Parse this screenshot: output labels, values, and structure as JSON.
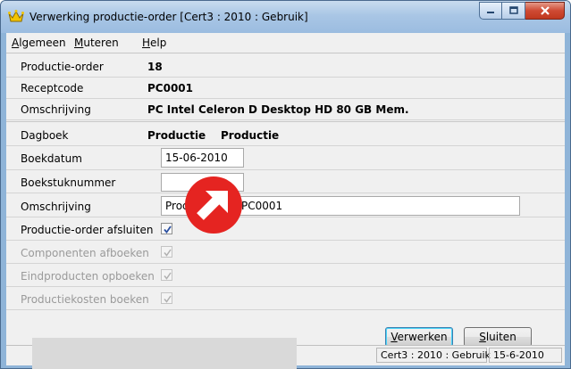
{
  "window": {
    "title": "Verwerking productie-order  [Cert3 : 2010 : Gebruik]"
  },
  "menu": {
    "items": [
      {
        "label": "Algemeen"
      },
      {
        "label": "Muteren"
      },
      {
        "label": "Help"
      }
    ]
  },
  "header_fields": [
    {
      "label": "Productie-order",
      "value": "18"
    },
    {
      "label": "Receptcode",
      "value": "PC0001"
    },
    {
      "label": "Omschrijving",
      "value": "PC Intel Celeron D Desktop HD 80 GB Mem."
    }
  ],
  "form": {
    "dagboek_label": "Dagboek",
    "dagboek_code": "Productie",
    "dagboek_name": "Productie",
    "boekdatum_label": "Boekdatum",
    "boekdatum_value": "15-06-2010",
    "boekstuknummer_label": "Boekstuknummer",
    "boekstuknummer_value": "",
    "omschrijving_label": "Omschrijving",
    "omschrijving_value_visible_left": "Prod",
    "omschrijving_value_visible_right": "PC0001"
  },
  "checkboxes": [
    {
      "label": "Productie-order afsluiten",
      "checked": true,
      "enabled": true
    },
    {
      "label": "Componenten afboeken",
      "checked": true,
      "enabled": false
    },
    {
      "label": "Eindproducten opboeken",
      "checked": true,
      "enabled": false
    },
    {
      "label": "Productiekosten boeken",
      "checked": true,
      "enabled": false
    }
  ],
  "buttons": {
    "verwerken": "Verwerken",
    "sluiten": "Sluiten"
  },
  "status": {
    "context": "Cert3 : 2010 : Gebruik",
    "date": "15-6-2010"
  },
  "colors": {
    "accent_badge": "#e52421",
    "check": "#2a4fa0"
  }
}
